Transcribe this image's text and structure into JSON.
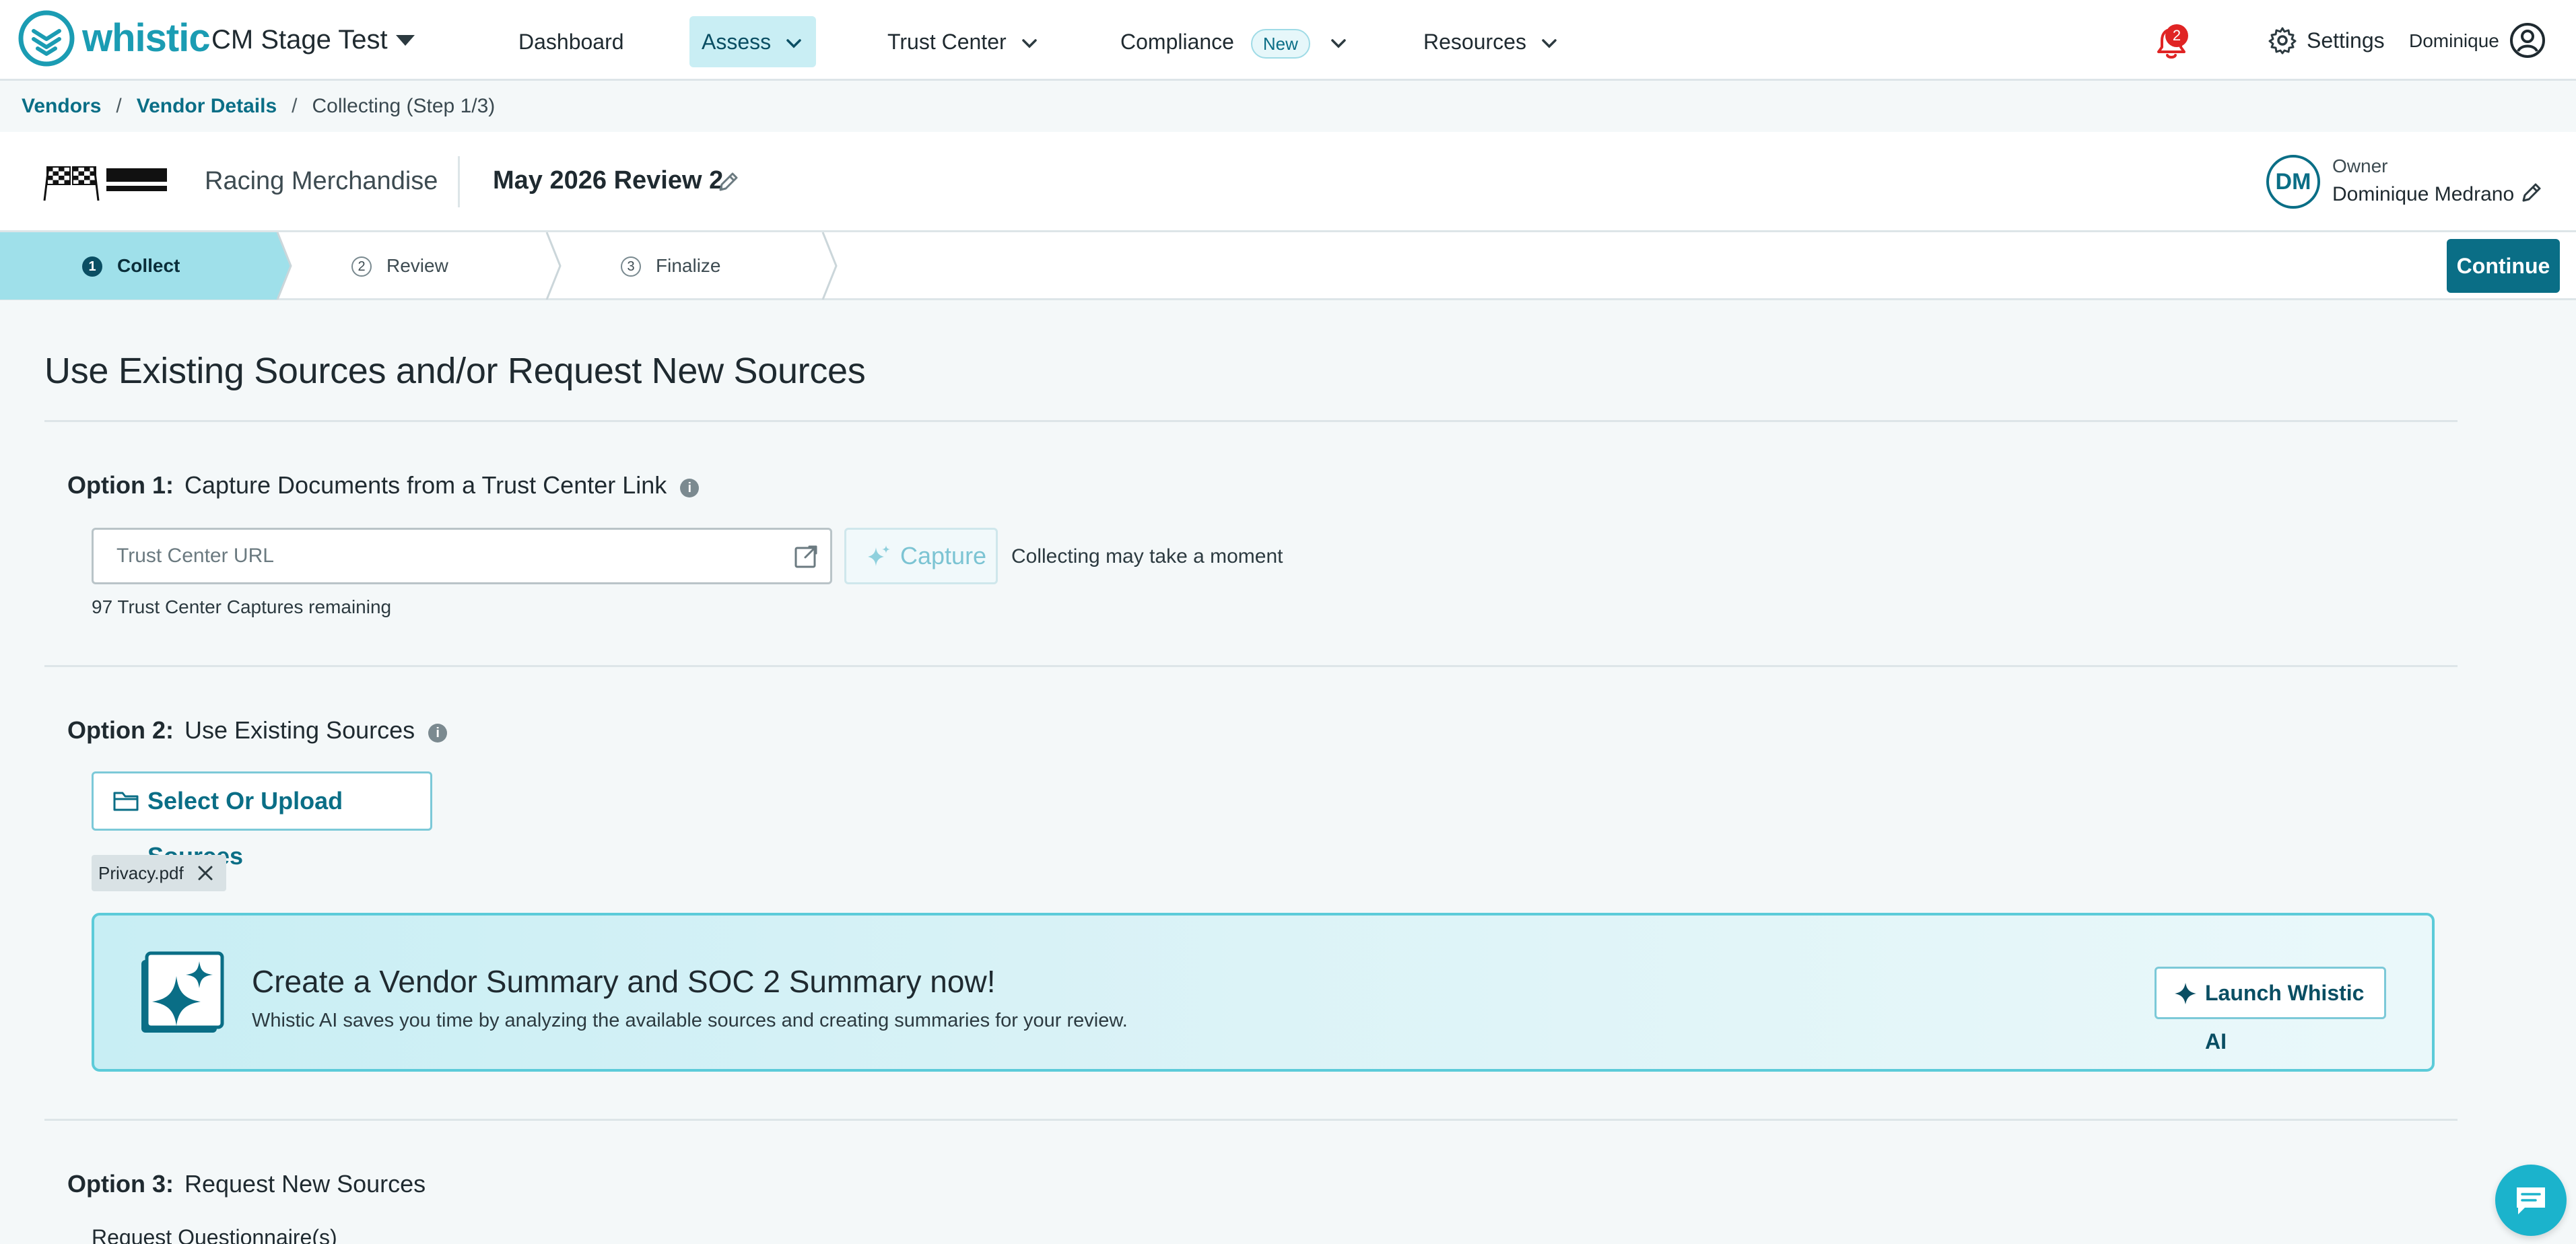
{
  "app": {
    "brand": "whistic",
    "org_name": "CM Stage Test"
  },
  "nav": {
    "items": [
      {
        "label": "Dashboard"
      },
      {
        "label": "Assess"
      },
      {
        "label": "Trust Center"
      },
      {
        "label": "Compliance",
        "badge": "New"
      },
      {
        "label": "Resources"
      }
    ],
    "notification_count": "2",
    "settings_label": "Settings",
    "user_name": "Dominique"
  },
  "breadcrumb": {
    "items": [
      "Vendors",
      "Vendor Details"
    ],
    "current": "Collecting (Step 1/3)"
  },
  "header": {
    "vendor_name": "Racing Merchandise",
    "review_name": "May 2026 Review 2",
    "owner_initials": "DM",
    "owner_label": "Owner",
    "owner_name": "Dominique Medrano"
  },
  "stepper": {
    "steps": [
      {
        "num": "1",
        "label": "Collect"
      },
      {
        "num": "2",
        "label": "Review"
      },
      {
        "num": "3",
        "label": "Finalize"
      }
    ],
    "active_step": 0,
    "continue_label": "Continue"
  },
  "main": {
    "title": "Use Existing Sources and/or Request New Sources",
    "option1": {
      "prefix": "Option 1:",
      "title": "Capture Documents from a Trust Center Link",
      "input_placeholder": "Trust Center URL",
      "input_value": "",
      "capture_label": "Capture",
      "note": "Collecting may take a moment",
      "remaining": "97 Trust Center Captures remaining"
    },
    "option2": {
      "prefix": "Option 2:",
      "title": "Use Existing Sources",
      "upload_label": "Select Or Upload Sources",
      "files": [
        "Privacy.pdf"
      ]
    },
    "ai_card": {
      "title": "Create a Vendor Summary and SOC 2 Summary now!",
      "subtitle": "Whistic AI saves you time by analyzing the available sources and creating summaries for your review.",
      "button_label": "Launch Whistic AI"
    },
    "option3": {
      "prefix": "Option 3:",
      "title": "Request New Sources",
      "sub_heading": "Request Questionnaire(s)"
    }
  },
  "colors": {
    "accent": "#0a6e86",
    "brand": "#1b9cb3",
    "active_nav_bg": "#c9eef4",
    "active_step_bg": "#9fe0ea",
    "notification": "#e02424"
  },
  "icons": {
    "nav_caret": "chevron-down-icon",
    "bell": "bell-icon",
    "settings": "gear-icon",
    "user": "user-circle-icon",
    "edit": "pencil-icon",
    "external": "external-link-icon",
    "capture": "sparkle-icon",
    "folder": "folder-icon",
    "remove": "close-icon",
    "chat": "chat-icon"
  }
}
